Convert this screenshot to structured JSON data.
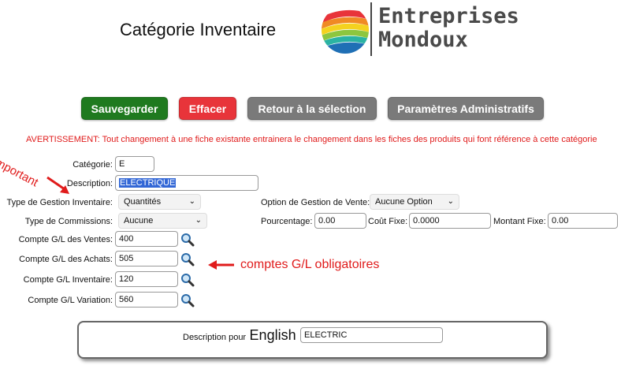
{
  "header": {
    "title": "Catégorie Inventaire",
    "logo_line1": "Entreprises",
    "logo_line2": "Mondoux"
  },
  "toolbar": {
    "save_label": "Sauvegarder",
    "clear_label": "Effacer",
    "back_label": "Retour à la sélection",
    "admin_label": "Paramètres Administratifs"
  },
  "warning": "AVERTISSEMENT: Tout changement à une fiche existante entrainera le changement dans les fiches des produits qui font référence à cette catégorie",
  "form": {
    "category_label": "Catégorie:",
    "category_value": "E",
    "description_label": "Description:",
    "description_value": "ELECTRIQUE",
    "inv_mgmt_label": "Type de Gestion Inventaire:",
    "inv_mgmt_value": "Quantités",
    "commission_label": "Type de Commissions:",
    "commission_value": "Aucune",
    "sales_acct_label": "Compte G/L des Ventes:",
    "sales_acct_value": "400",
    "purch_acct_label": "Compte G/L des Achats:",
    "purch_acct_value": "505",
    "inv_acct_label": "Compte G/L Inventaire:",
    "inv_acct_value": "120",
    "var_acct_label": "Compte G/L Variation:",
    "var_acct_value": "560",
    "sale_option_label": "Option de Gestion de Vente:",
    "sale_option_value": "Aucune Option",
    "percent_label": "Pourcentage:",
    "percent_value": "0.00",
    "fixed_cost_label": "Coût Fixe:",
    "fixed_cost_value": "0.0000",
    "fixed_amount_label": "Montant Fixe:",
    "fixed_amount_value": "0.00"
  },
  "annotations": {
    "important": "important",
    "gl_required": "comptes G/L obligatoires"
  },
  "english": {
    "prefix": "Description pour",
    "language": "English",
    "value": "ELECTRIC"
  },
  "colors": {
    "save": "#1f7a1f",
    "clear": "#e8343a",
    "gray": "#7a7a7a",
    "warning": "#e01b1b"
  }
}
